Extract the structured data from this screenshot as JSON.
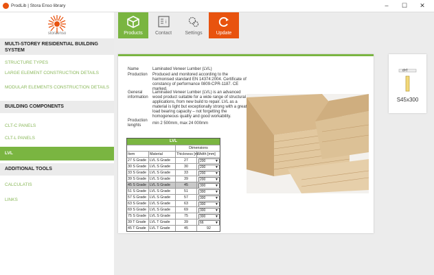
{
  "window": {
    "title": "ProdLib | Stora Enso library",
    "minimize": "–",
    "maximize": "☐",
    "close": "✕"
  },
  "brand": "storaenso",
  "sidebar": {
    "sections": [
      "MULTI-STOREY RESIDENTIAL BUILDING SYSTEM",
      "BUILDING COMPONENTS",
      "ADDITIONAL TOOLS"
    ],
    "items": [
      "STRUCTURE TYPES",
      "LARGE ELEMENT CONSTRUCTION DETAILS",
      "MODULAR ELEMENTS CONSTRUCTION DETAILS",
      "CLT-C PANELS",
      "CLT-L PANELS",
      "LVL",
      "CALCULATIS",
      "LINKS"
    ]
  },
  "tabs": [
    "Products",
    "Contact",
    "Settings",
    "Update"
  ],
  "product": {
    "labels": {
      "name": "Name",
      "production": "Production",
      "general": "General information",
      "lengths": "Production lenghts"
    },
    "name": "Laminated Veneer Lumber (LVL)",
    "production": "Produced and monitored according to the harmonised standard EN 14374:2004. Certificate of constancy of performance 0809-CPR-1187. CE marked.",
    "general": "Laminated Veneer Lumber (LVL) is an advanced wood product suitable for a wide range of structural applications, from new build to repair. LVL as a material is light but exceptionally strong with a great load bearing capacity – not forgetting the homogeneous quality and good workability.",
    "lengths": "min 2 500mm, max 24 000mm"
  },
  "table": {
    "title": "LVL",
    "dims_header": "Dimensions",
    "headers": [
      "Item",
      "Material",
      "Thickness [mm]",
      "Width [mm]"
    ],
    "rows": [
      {
        "item": "27 S Grade",
        "material": "LVL S Grade",
        "thickness": "27",
        "width": "200",
        "dropdown": true
      },
      {
        "item": "30 S Grade",
        "material": "LVL S Grade",
        "thickness": "30",
        "width": "200",
        "dropdown": true
      },
      {
        "item": "33 S Grade",
        "material": "LVL S Grade",
        "thickness": "33",
        "width": "200",
        "dropdown": true
      },
      {
        "item": "39 S Grade",
        "material": "LVL S Grade",
        "thickness": "39",
        "width": "200",
        "dropdown": true
      },
      {
        "item": "45 S Grade",
        "material": "LVL S Grade",
        "thickness": "45",
        "width": "300",
        "dropdown": true,
        "selected": true
      },
      {
        "item": "51 S Grade",
        "material": "LVL S Grade",
        "thickness": "51",
        "width": "300",
        "dropdown": true
      },
      {
        "item": "57 S Grade",
        "material": "LVL S Grade",
        "thickness": "57",
        "width": "300",
        "dropdown": true
      },
      {
        "item": "63 S Grade",
        "material": "LVL S Grade",
        "thickness": "63",
        "width": "300",
        "dropdown": true
      },
      {
        "item": "69 S Grade",
        "material": "LVL S Grade",
        "thickness": "69",
        "width": "300",
        "dropdown": true
      },
      {
        "item": "75 S Grade",
        "material": "LVL S Grade",
        "thickness": "75",
        "width": "300",
        "dropdown": true
      },
      {
        "item": "39 T Grade",
        "material": "LVL T Grade",
        "thickness": "39",
        "width": "66",
        "dropdown": true
      },
      {
        "item": "45 T Grade",
        "material": "LVL T Grade",
        "thickness": "45",
        "width": "92",
        "dropdown": false
      }
    ]
  },
  "card": {
    "dim_label": "d×f",
    "size": "S45x300"
  },
  "colors": {
    "accent": "#7ab541",
    "update": "#e8530f",
    "link": "#8ab85a"
  }
}
